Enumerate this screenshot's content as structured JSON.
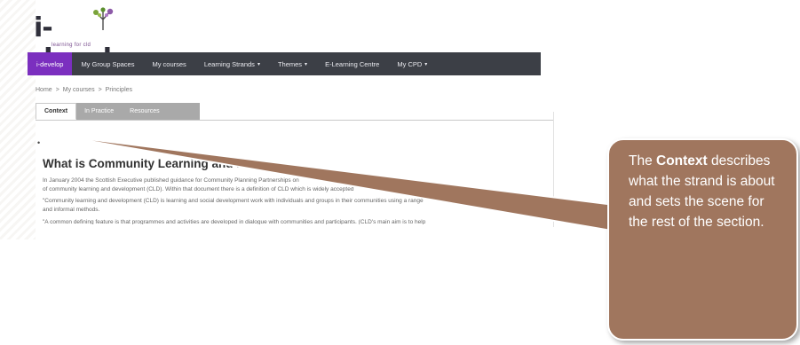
{
  "logo": {
    "text": "i-develop",
    "tagline": "learning for cld",
    "icon": "tree-icon"
  },
  "navbar": {
    "items": [
      {
        "label": "i-develop",
        "active": true,
        "dropdown": false
      },
      {
        "label": "My Group Spaces",
        "active": false,
        "dropdown": false
      },
      {
        "label": "My courses",
        "active": false,
        "dropdown": false
      },
      {
        "label": "Learning Strands",
        "active": false,
        "dropdown": true
      },
      {
        "label": "Themes",
        "active": false,
        "dropdown": true
      },
      {
        "label": "E-Learning Centre",
        "active": false,
        "dropdown": false
      },
      {
        "label": "My CPD",
        "active": false,
        "dropdown": true
      }
    ],
    "caret": "▾"
  },
  "breadcrumb": {
    "items": [
      "Home",
      "My courses",
      "Principles"
    ],
    "separator": ">"
  },
  "tabs": [
    {
      "label": "Context",
      "active": true
    },
    {
      "label": "In Practice",
      "active": false
    },
    {
      "label": "Resources",
      "active": false
    }
  ],
  "content": {
    "bullet": "•",
    "heading": "What is Community Learning and Development?",
    "paragraphs": [
      "In January 2004 the Scottish Executive published guidance for Community Planning Partnerships on",
      "of community learning and development (CLD). Within that document there is a definition of CLD which is widely accepted",
      "\"Community learning and development (CLD) is learning and social development work with individuals and groups in their communities using a range",
      "and informal methods.",
      "\"A common defining feature is that programmes and activities are developed in dialogue with communities and participants. (CLD's main aim is to help"
    ]
  },
  "callout": {
    "bold_word": "Context",
    "prefix": "The ",
    "suffix": " describes what the strand is about and sets the scene for the rest of the section.",
    "fill_color": "#a0765e"
  },
  "colors": {
    "navbar_bg": "#3c3f46",
    "nav_active": "#7b2fbf",
    "tab_inactive": "#a9a9a9",
    "callout": "#a0765e"
  }
}
